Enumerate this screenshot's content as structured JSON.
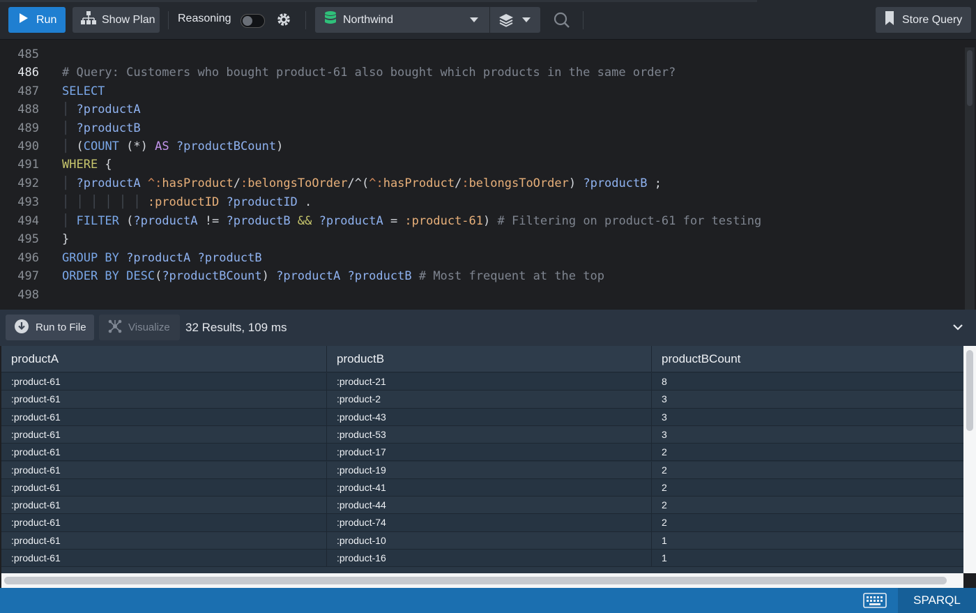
{
  "toolbar": {
    "run_label": "Run",
    "show_plan_label": "Show Plan",
    "reasoning_label": "Reasoning",
    "reasoning_enabled": false,
    "database_label": "Northwind",
    "store_query_label": "Store Query"
  },
  "editor": {
    "line_numbers": [
      "485",
      "486",
      "487",
      "488",
      "489",
      "490",
      "491",
      "492",
      "493",
      "494",
      "495",
      "496",
      "497",
      "498"
    ],
    "active_line": "486"
  },
  "results_bar": {
    "run_to_file_label": "Run to File",
    "visualize_label": "Visualize",
    "results_count": "32 Results,  109 ms"
  },
  "table": {
    "headers": [
      "productA",
      "productB",
      "productBCount"
    ],
    "rows": [
      [
        ":product-61",
        ":product-21",
        "8"
      ],
      [
        ":product-61",
        ":product-2",
        "3"
      ],
      [
        ":product-61",
        ":product-43",
        "3"
      ],
      [
        ":product-61",
        ":product-53",
        "3"
      ],
      [
        ":product-61",
        ":product-17",
        "2"
      ],
      [
        ":product-61",
        ":product-19",
        "2"
      ],
      [
        ":product-61",
        ":product-41",
        "2"
      ],
      [
        ":product-61",
        ":product-44",
        "2"
      ],
      [
        ":product-61",
        ":product-74",
        "2"
      ],
      [
        ":product-61",
        ":product-10",
        "1"
      ],
      [
        ":product-61",
        ":product-16",
        "1"
      ]
    ]
  },
  "statusbar": {
    "language": "SPARQL"
  },
  "colors": {
    "run_button": "#1f7fd1",
    "status_bar": "#1b6fb0",
    "db_icon": "#2fc07a"
  }
}
